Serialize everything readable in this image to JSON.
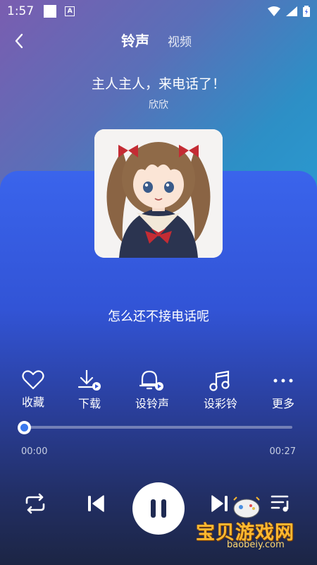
{
  "status_bar": {
    "time": "1:57"
  },
  "header": {
    "tab_active": "铃声",
    "tab_other": "视频"
  },
  "song": {
    "title": "主人主人，来电话了！",
    "artist": "欣欣",
    "lyric": "怎么还不接电话呢"
  },
  "actions": [
    {
      "label": "收藏",
      "icon": "heart-icon"
    },
    {
      "label": "下载",
      "icon": "download-icon"
    },
    {
      "label": "设铃声",
      "icon": "bell-icon"
    },
    {
      "label": "设彩铃",
      "icon": "music-note-icon"
    },
    {
      "label": "更多",
      "icon": "more-icon"
    }
  ],
  "player": {
    "current_time": "00:00",
    "total_time": "00:27",
    "progress_fraction": 0.0
  },
  "watermark": {
    "title": "宝贝游戏网",
    "url": "baobeiy.com"
  },
  "colors": {
    "accent": "#3a78ee",
    "watermark": "#ffb830"
  }
}
